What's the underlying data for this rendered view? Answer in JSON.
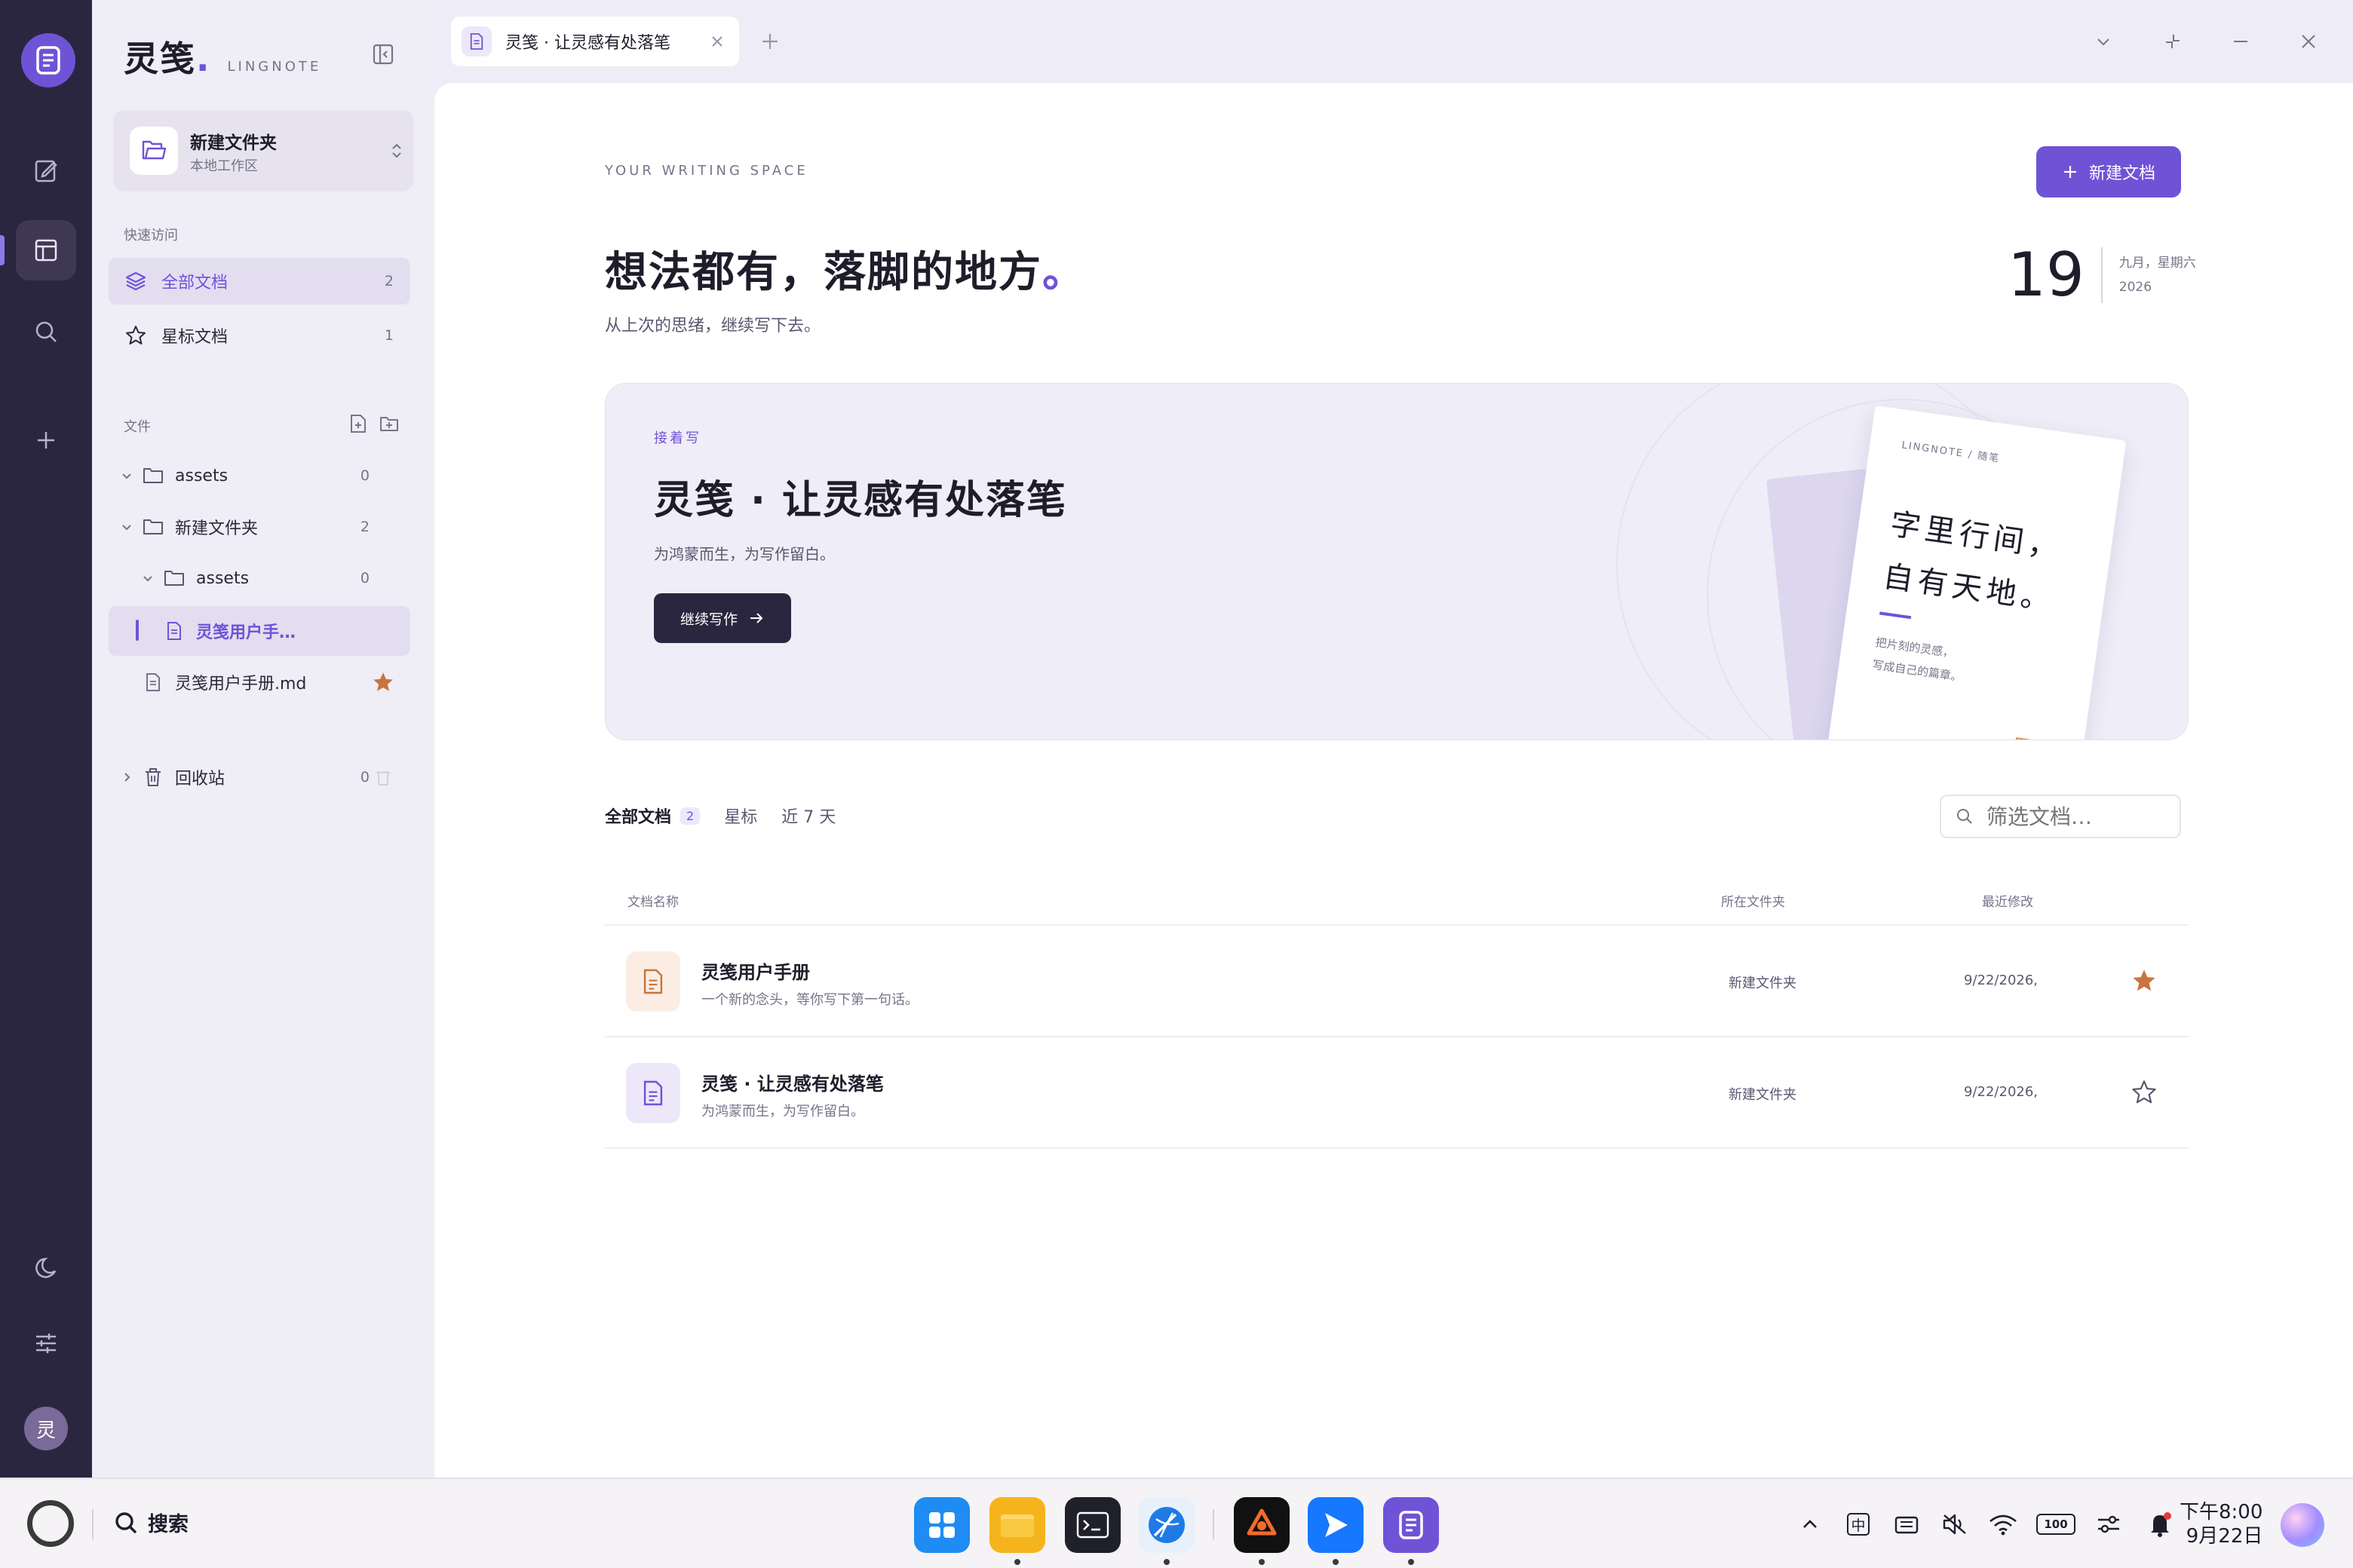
{
  "app": {
    "brand_name": "灵笺",
    "brand_dot": ".",
    "brand_sub": "LINGNOTE",
    "avatar_char": "灵"
  },
  "workspace": {
    "title": "新建文件夹",
    "subtitle": "本地工作区"
  },
  "sidebar": {
    "quick_label": "快速访问",
    "quick_items": [
      {
        "label": "全部文档",
        "count": "2"
      },
      {
        "label": "星标文档",
        "count": "1"
      }
    ],
    "files_label": "文件",
    "tree": [
      {
        "label": "assets",
        "count": "0"
      },
      {
        "label": "新建文件夹",
        "count": "2"
      },
      {
        "label": "assets",
        "count": "0"
      },
      {
        "label": "灵笺用户手…"
      },
      {
        "label": "灵笺用户手册.md"
      }
    ],
    "trash": {
      "label": "回收站",
      "count": "0"
    }
  },
  "tab": {
    "label": "灵笺 · 让灵感有处落笔"
  },
  "main": {
    "eyebrow": "YOUR WRITING SPACE",
    "heading": "想法都有，落脚的地方",
    "heading_accent": "。",
    "subheading": "从上次的思绪，继续写下去。",
    "new_doc_label": "新建文档",
    "date": {
      "day": "19",
      "line1": "九月，星期六",
      "line2": "2026"
    },
    "hero": {
      "kicker": "接着写",
      "title": "灵笺 · 让灵感有处落笔",
      "desc": "为鸿蒙而生，为写作留白。",
      "button": "继续写作",
      "card_tag": "LINGNOTE / 随笔",
      "card_line1": "字里行间，",
      "card_line2": "自有天地。",
      "card_small1": "把片刻的灵感，",
      "card_small2": "写成自己的篇章。",
      "card_seal": "笺"
    },
    "filter_tabs": [
      {
        "label": "全部文档",
        "badge": "2"
      },
      {
        "label": "星标"
      },
      {
        "label": "近 7 天"
      }
    ],
    "filter_placeholder": "筛选文档…",
    "table": {
      "col_name": "文档名称",
      "col_folder": "所在文件夹",
      "col_modified": "最近修改",
      "rows": [
        {
          "title": "灵笺用户手册",
          "desc": "一个新的念头，等你写下第一句话。",
          "folder": "新建文件夹",
          "modified": "9/22/2026,",
          "starred": true
        },
        {
          "title": "灵笺 · 让灵感有处落笔",
          "desc": "为鸿蒙而生，为写作留白。",
          "folder": "新建文件夹",
          "modified": "9/22/2026,",
          "starred": false
        }
      ]
    }
  },
  "taskbar": {
    "search_label": "搜索",
    "ime": "中",
    "battery": "100",
    "time": "下午8:00",
    "date": "9月22日"
  },
  "colors": {
    "accent": "#6f53d6",
    "rail": "#2b2640",
    "star": "#c9743f"
  }
}
